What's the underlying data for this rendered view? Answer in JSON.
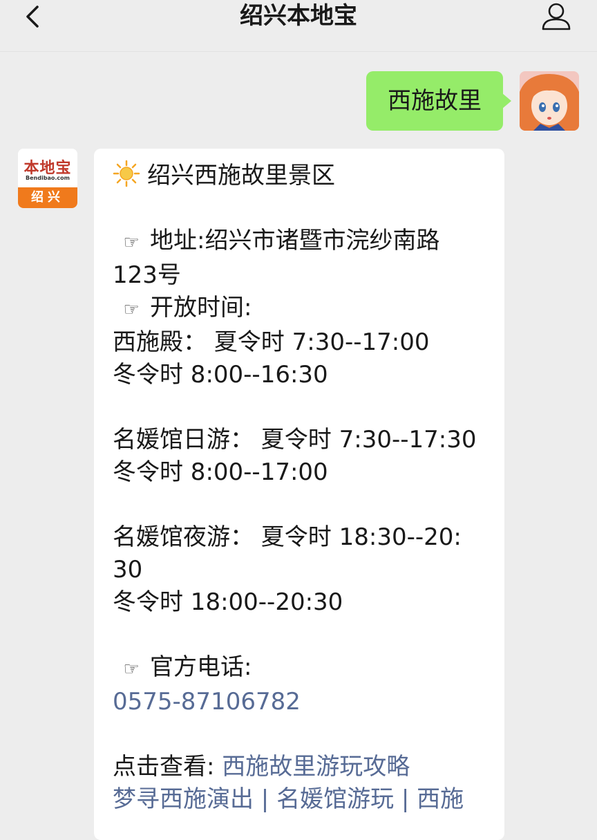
{
  "header": {
    "title": "绍兴本地宝",
    "back_icon": "chevron-left-icon",
    "profile_icon": "user-icon"
  },
  "sent_message": {
    "text": "西施故里"
  },
  "bot_avatar": {
    "logo_text": "本地宝",
    "logo_url": "Bendibao.com",
    "city": "绍兴"
  },
  "reply": {
    "title": "绍兴西施故里景区",
    "pointer": "☞",
    "address_label": "地址:",
    "address_value": "绍兴市诸暨市浣纱南路",
    "address_cont": "123号",
    "hours_label": "开放时间:",
    "xishi_hall": "西施殿：  夏令时 7:30--17:00",
    "xishi_hall_winter": "冬令时 8:00--16:30",
    "day_tour": "名媛馆日游：  夏令时 7:30--17:30",
    "day_tour_winter": "冬令时 8:00--17:00",
    "night_tour": "名媛馆夜游：  夏令时 18:30--20:",
    "night_tour_cont": "30",
    "night_tour_winter": "冬令时 18:00--20:30",
    "phone_label": "官方电话:",
    "phone_value": "0575-87106782",
    "see_more_label": "点击查看:",
    "see_more_link": "西施故里游玩攻略",
    "more_links": "梦寻西施演出 | 名媛馆游玩 | 西施"
  },
  "colors": {
    "background": "#ededed",
    "sent_bubble": "#95ec69",
    "link": "#576b95"
  }
}
